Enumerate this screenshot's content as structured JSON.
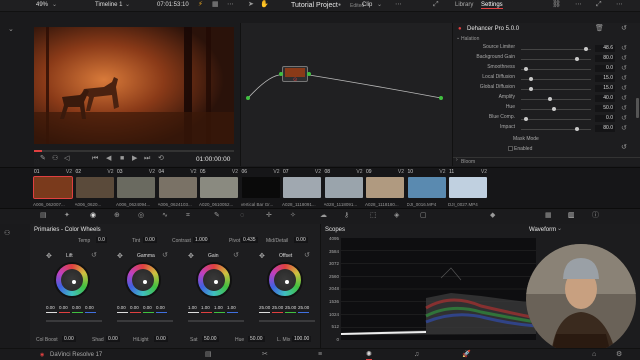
{
  "topbar": {
    "zoom": "49%",
    "timeline": "Timeline 1",
    "timecode": "07:01:53:10",
    "project": "Tutorial Project",
    "edited": "Edited",
    "clip": "Clip",
    "library_tab": "Library",
    "settings_tab": "Settings"
  },
  "transport": {
    "timecode": "01:00:00:00"
  },
  "panel": {
    "plugin": "Dehancer Pro 5.0.0",
    "section": "Halation",
    "settings": [
      {
        "label": "Source Limiter",
        "value": "48.6",
        "pos": 0.92
      },
      {
        "label": "Background Gain",
        "value": "80.0",
        "pos": 0.8
      },
      {
        "label": "Smoothness",
        "value": "0.0",
        "pos": 0.05
      },
      {
        "label": "Local Diffusion",
        "value": "15.0",
        "pos": 0.12
      },
      {
        "label": "Global Diffusion",
        "value": "15.0",
        "pos": 0.12
      },
      {
        "label": "Amplify",
        "value": "40.0",
        "pos": 0.4
      },
      {
        "label": "Hue",
        "value": "50.0",
        "pos": 0.45
      },
      {
        "label": "Blue Comp.",
        "value": "0.0",
        "pos": 0.05
      },
      {
        "label": "Impact",
        "value": "80.0",
        "pos": 0.8
      }
    ],
    "mask_mode": "Mask Mode",
    "enabled": "Enabled",
    "bloom": "Bloom"
  },
  "clips": [
    {
      "num": "01",
      "trk": "V2",
      "name": "A006_062007...",
      "color": "#7a3a1c",
      "selected": true
    },
    {
      "num": "02",
      "trk": "V2",
      "name": "A006_0620...",
      "color": "#5a4a3a"
    },
    {
      "num": "03",
      "trk": "V2",
      "name": "A006_0624094...",
      "color": "#6a6a60"
    },
    {
      "num": "04",
      "trk": "V2",
      "name": "A006_0624103...",
      "color": "#7a7266"
    },
    {
      "num": "05",
      "trk": "V2",
      "name": "A020_0610052...",
      "color": "#8a8a80"
    },
    {
      "num": "06",
      "trk": "V2",
      "name": "Vertical Bar Gr...",
      "color": "#0a0a0a"
    },
    {
      "num": "07",
      "trk": "V2",
      "name": "A028_1118091...",
      "color": "#a0a8b0"
    },
    {
      "num": "08",
      "trk": "V2",
      "name": "A028_1118091...",
      "color": "#9aa4ac"
    },
    {
      "num": "09",
      "trk": "V2",
      "name": "A028_1118180...",
      "color": "#b09a80"
    },
    {
      "num": "10",
      "trk": "V2",
      "name": "DJI_0016.MP4",
      "color": "#5a8ab0"
    },
    {
      "num": "11",
      "trk": "V2",
      "name": "DJI_0027.MP4",
      "color": "#c0d0e0"
    }
  ],
  "primaries": {
    "title": "Primaries - Color Wheels",
    "temp_label": "Temp",
    "temp": "0.0",
    "tint_label": "Tint",
    "tint": "0.00",
    "contrast_label": "Contrast",
    "contrast": "1.000",
    "pivot_label": "Pivot",
    "pivot": "0.435",
    "middetail_label": "Mid/Detail",
    "middetail": "0.00",
    "wheels": [
      {
        "name": "Lift",
        "values": [
          "0.00",
          "0.00",
          "0.00",
          "0.00"
        ]
      },
      {
        "name": "Gamma",
        "values": [
          "0.00",
          "0.00",
          "0.00",
          "0.00"
        ]
      },
      {
        "name": "Gain",
        "values": [
          "1.00",
          "1.00",
          "1.00",
          "1.00"
        ]
      },
      {
        "name": "Offset",
        "values": [
          "25.00",
          "25.00",
          "25.00",
          "25.00"
        ]
      }
    ],
    "col_boost_label": "Col Boost",
    "col_boost": "0.00",
    "shad_label": "Shad",
    "shad": "0.00",
    "hilight_label": "HiLight",
    "hilight": "0.00",
    "sat_label": "Sat",
    "sat": "50.00",
    "hue_label": "Hue",
    "hue": "50.00",
    "lmix_label": "L. Mix",
    "lmix": "100.00"
  },
  "scopes": {
    "title": "Scopes",
    "mode": "Waveform",
    "ticks": [
      "4095",
      "3584",
      "3072",
      "2560",
      "2048",
      "1536",
      "1024",
      "512",
      "0"
    ]
  },
  "bottombar": {
    "app": "DaVinci Resolve 17"
  }
}
